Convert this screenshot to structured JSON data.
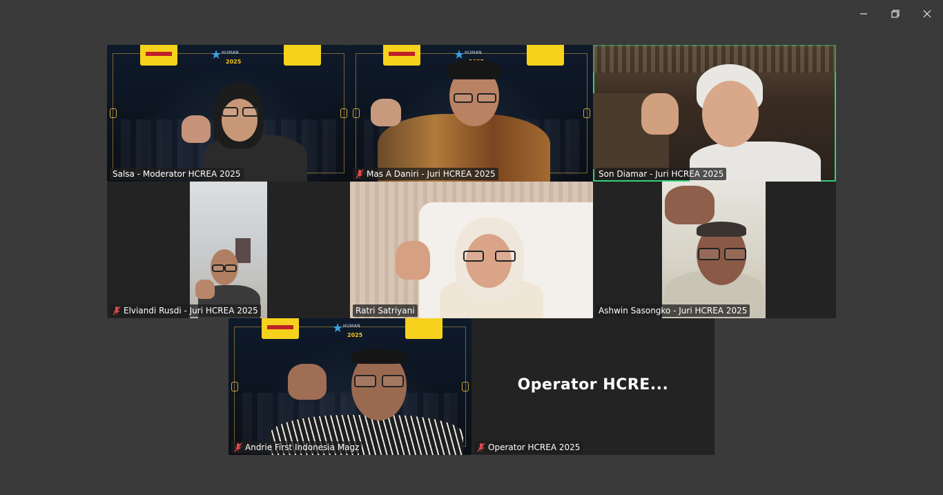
{
  "window_controls": {
    "minimize": "minimize",
    "restore": "restore",
    "close": "close"
  },
  "participants": [
    {
      "name": "Salsa - Moderator HCREA 2025",
      "muted": false,
      "active": false
    },
    {
      "name": "Mas A Daniri - Juri HCREA 2025",
      "muted": true,
      "active": false
    },
    {
      "name": "Son Diamar - Juri HCREA 2025",
      "muted": false,
      "active": true
    },
    {
      "name": "Elviandi Rusdi - Juri HCREA 2025",
      "muted": true,
      "active": false
    },
    {
      "name": "Ratri Satriyani",
      "muted": false,
      "active": false
    },
    {
      "name": "Ashwin Sasongko - Juri HCREA 2025",
      "muted": false,
      "active": false
    },
    {
      "name": "Andrie First Indonesia Magz",
      "muted": true,
      "active": false
    },
    {
      "name": "Operator HCREA 2025",
      "muted": true,
      "active": false,
      "display_name": "Operator  HCRE..."
    }
  ],
  "event_banner": {
    "line1": "HUMAN",
    "line2": "CAPITAL",
    "year": "2025"
  },
  "colors": {
    "active_border": "#33d17a",
    "muted_icon": "#e5484d",
    "background": "#3a3a3a"
  }
}
